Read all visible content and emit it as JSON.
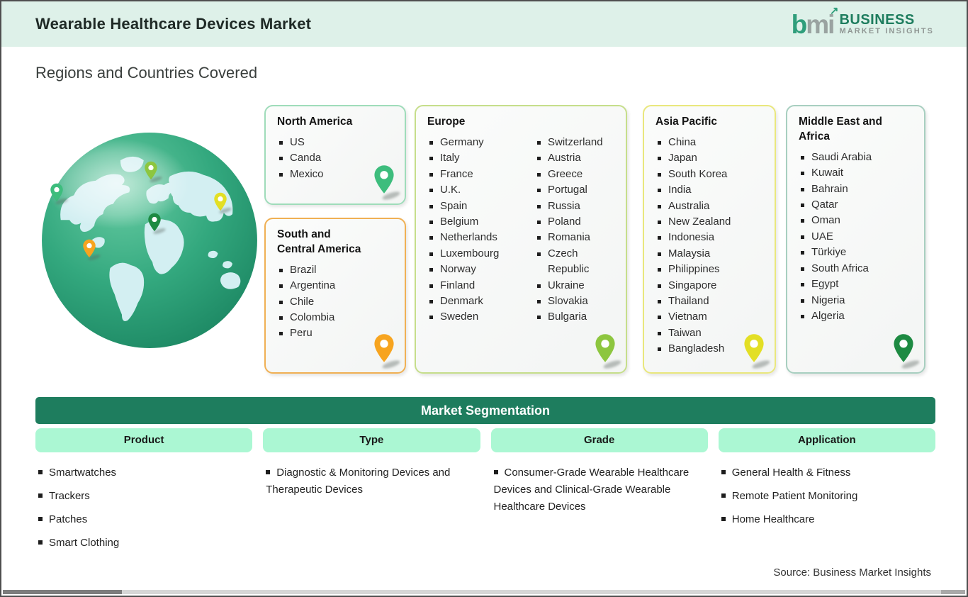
{
  "header": {
    "title": "Wearable Healthcare Devices Market",
    "logo": {
      "mark_b": "b",
      "mark_mi": "mi",
      "arrow": "↗",
      "name_line1": "BUSINESS",
      "name_line2": "MARKET INSIGHTS"
    }
  },
  "section_title": "Regions and Countries Covered",
  "colors": {
    "header_band": "#def1e9",
    "banner_green": "#1e7d5e",
    "subheader_green": "#abf7d3",
    "logo_green": "#1e7d5e",
    "logo_gray": "#9aa3a1"
  },
  "regions": {
    "north_america": {
      "title": "North America",
      "border": "#9fdcba",
      "pin": "#3dbd7d",
      "countries": [
        "US",
        "Canda",
        "Mexico"
      ]
    },
    "south_central_america": {
      "title": "South and\nCentral America",
      "border": "#f0b054",
      "pin": "#f7a41f",
      "countries": [
        "Brazil",
        "Argentina",
        "Chile",
        "Colombia",
        "Peru"
      ]
    },
    "europe": {
      "title": "Europe",
      "border": "#c6de8b",
      "pin": "#8dc63f",
      "countries_col1": [
        "Germany",
        "Italy",
        "France",
        "U.K.",
        "Spain",
        "Belgium",
        "Netherlands",
        "Luxembourg",
        "Norway",
        "Finland",
        "Denmark",
        "Sweden"
      ],
      "countries_col2": [
        "Switzerland",
        "Austria",
        "Greece",
        "Portugal",
        "Russia",
        "Poland",
        "Romania",
        "Czech Republic",
        "Ukraine",
        "Slovakia",
        "Bulgaria"
      ]
    },
    "asia_pacific": {
      "title": "Asia Pacific",
      "border": "#e9e77d",
      "pin": "#e3df25",
      "countries": [
        "China",
        "Japan",
        "South Korea",
        "India",
        "Australia",
        "New Zealand",
        "Indonesia",
        "Malaysia",
        "Philippines",
        "Singapore",
        "Thailand",
        "Vietnam",
        "Taiwan",
        "Bangladesh"
      ]
    },
    "middle_east_africa": {
      "title": "Middle East and Africa",
      "border": "#a8cfc0",
      "pin": "#1d8a42",
      "countries": [
        "Saudi Arabia",
        "Kuwait",
        "Bahrain",
        "Qatar",
        "Oman",
        "UAE",
        "Türkiye",
        "South Africa",
        "Egypt",
        "Nigeria",
        "Algeria"
      ]
    }
  },
  "segmentation": {
    "banner": "Market Segmentation",
    "columns": [
      {
        "title": "Product",
        "items": [
          "Smartwatches",
          "Trackers",
          "Patches",
          "Smart Clothing"
        ]
      },
      {
        "title": "Type",
        "items": [
          "Diagnostic & Monitoring Devices and Therapeutic Devices"
        ]
      },
      {
        "title": "Grade",
        "items": [
          "Consumer-Grade Wearable Healthcare Devices and Clinical-Grade Wearable Healthcare Devices"
        ]
      },
      {
        "title": "Application",
        "items": [
          "General Health & Fitness",
          "Remote Patient Monitoring",
          "Home Healthcare"
        ]
      }
    ]
  },
  "footer": {
    "source": "Source: Business Market Insights"
  }
}
